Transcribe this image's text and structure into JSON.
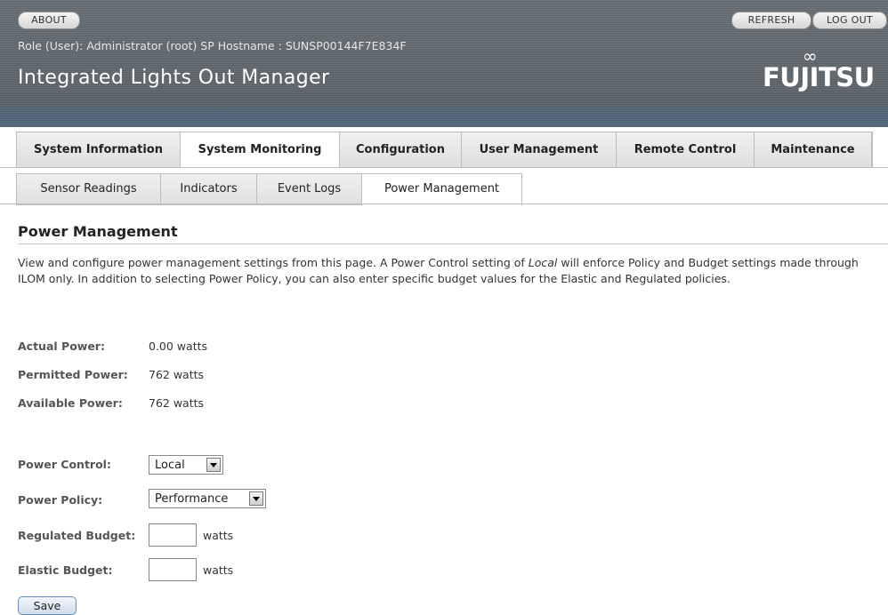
{
  "header": {
    "about_label": "ABOUT",
    "refresh_label": "REFRESH",
    "logout_label": "LOG OUT",
    "role_text": "Role (User): Administrator (root)   SP Hostname : SUNSP00144F7E834F",
    "app_title": "Integrated Lights Out Manager",
    "logo_text": "FUJITSU"
  },
  "main_tabs": [
    {
      "label": "System Information",
      "active": false
    },
    {
      "label": "System Monitoring",
      "active": true
    },
    {
      "label": "Configuration",
      "active": false
    },
    {
      "label": "User Management",
      "active": false
    },
    {
      "label": "Remote Control",
      "active": false
    },
    {
      "label": "Maintenance",
      "active": false
    }
  ],
  "sub_tabs": [
    {
      "label": "Sensor Readings",
      "active": false
    },
    {
      "label": "Indicators",
      "active": false
    },
    {
      "label": "Event Logs",
      "active": false
    },
    {
      "label": "Power Management",
      "active": true
    }
  ],
  "page": {
    "title": "Power Management",
    "desc_part1": "View and configure power management settings from this page. A Power Control setting of ",
    "desc_emph": "Local",
    "desc_part2": " will enforce Policy and Budget settings made through ILOM only. In addition to selecting Power Policy, you can also enter specific budget values for the Elastic and Regulated policies."
  },
  "readings": [
    {
      "label": "Actual Power:",
      "value": "0.00 watts"
    },
    {
      "label": "Permitted Power:",
      "value": "762 watts"
    },
    {
      "label": "Available Power:",
      "value": "762 watts"
    }
  ],
  "form": {
    "power_control_label": "Power Control:",
    "power_control_value": "Local",
    "power_policy_label": "Power Policy:",
    "power_policy_value": "Performance",
    "regulated_label": "Regulated Budget:",
    "regulated_value": "",
    "elastic_label": "Elastic Budget:",
    "elastic_value": "",
    "unit": "watts",
    "save_label": "Save"
  },
  "colors": {
    "header_bg": "#646c72",
    "header_strip": "#566779",
    "tab_active_bg": "#ffffff",
    "save_button_border": "#6c8fb6"
  }
}
